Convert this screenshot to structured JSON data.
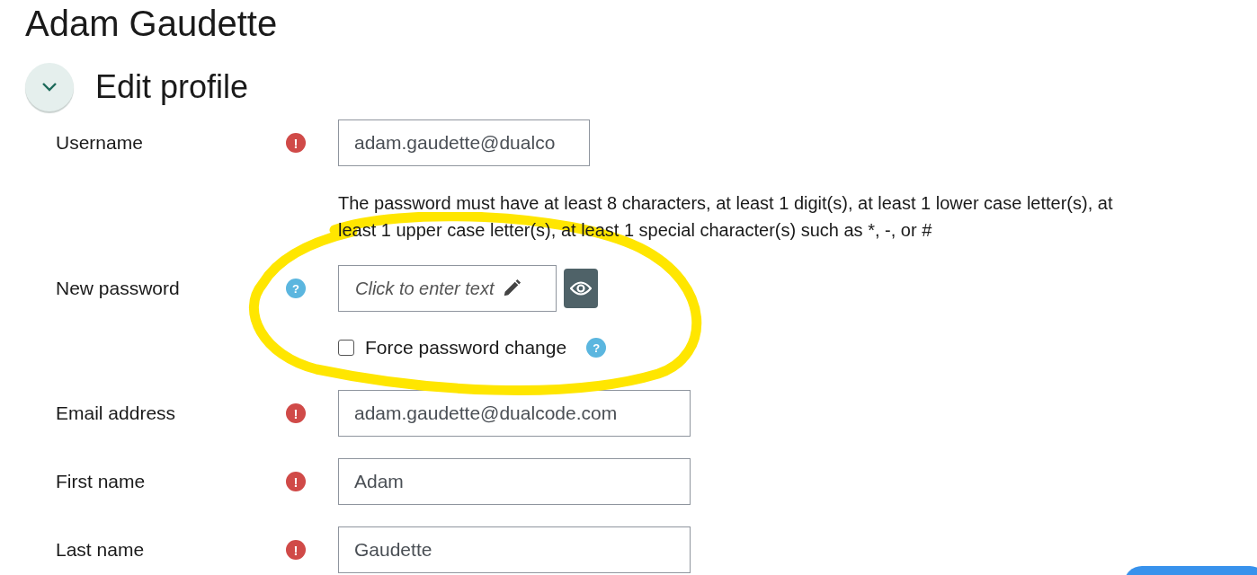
{
  "page_title": "Adam Gaudette",
  "section": {
    "title": "Edit profile",
    "expanded": true
  },
  "fields": [
    {
      "kind": "text",
      "label": "Username",
      "required": true,
      "status_icon": "!",
      "value": "adam.gaudette@dualco",
      "wide": false
    },
    {
      "kind": "password",
      "label": "New password",
      "required": false,
      "status_icon": "?",
      "help_text": "The password must have at least 8 characters, at least 1 digit(s), at least 1 lower case letter(s), at least 1 upper case letter(s), at least 1 special character(s) such as *, -, or #",
      "placeholder": "Click to enter text",
      "checkbox": {
        "label": "Force password change",
        "checked": false,
        "help_icon": "?"
      }
    },
    {
      "kind": "text",
      "label": "Email address",
      "required": true,
      "status_icon": "!",
      "value": "adam.gaudette@dualcode.com",
      "wide": true
    },
    {
      "kind": "text",
      "label": "First name",
      "required": true,
      "status_icon": "!",
      "value": "Adam",
      "wide": true
    },
    {
      "kind": "text",
      "label": "Last name",
      "required": true,
      "status_icon": "!",
      "value": "Gaudette",
      "wide": true
    }
  ]
}
